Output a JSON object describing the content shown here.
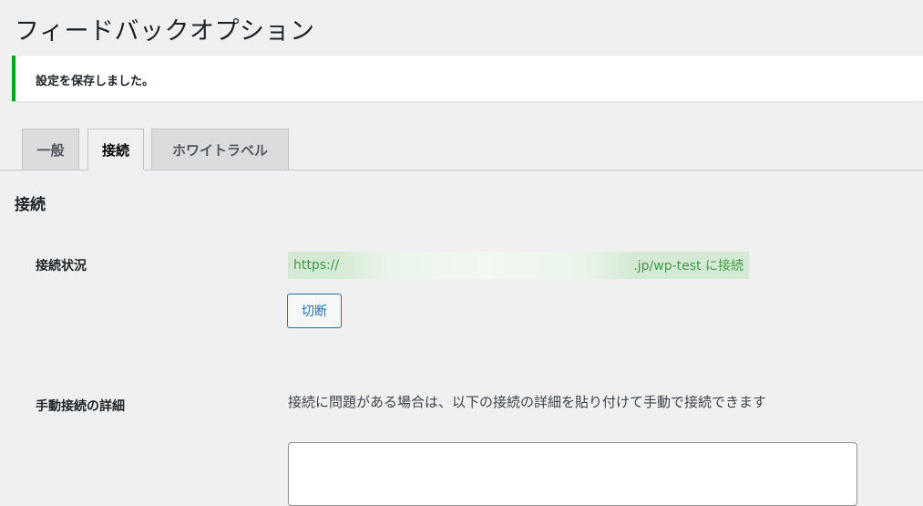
{
  "page": {
    "title": "フィードバックオプション"
  },
  "notice": {
    "text": "設定を保存しました。"
  },
  "tabs": [
    {
      "label": "一般",
      "active": false
    },
    {
      "label": "接続",
      "active": true
    },
    {
      "label": "ホワイトラベル",
      "active": false
    }
  ],
  "section": {
    "title": "接続"
  },
  "connection_status": {
    "label": "接続状況",
    "url_prefix": "https://",
    "url_suffix": ".jp/wp-test に接続",
    "disconnect_label": "切断"
  },
  "manual_connection": {
    "label": "手動接続の詳細",
    "description": "接続に問題がある場合は、以下の接続の詳細を貼り付けて手動で接続できます",
    "value": ""
  },
  "colors": {
    "notice_success": "#00a32a",
    "status_bg": "#d4ead4",
    "status_text": "#3f9b45",
    "button_accent": "#2271b1"
  }
}
